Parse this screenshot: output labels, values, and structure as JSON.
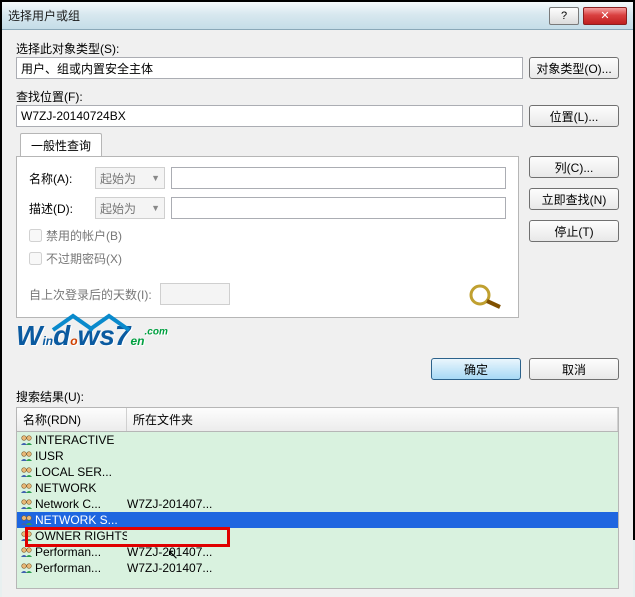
{
  "window": {
    "title": "选择用户或组"
  },
  "labels": {
    "select_type": "选择此对象类型(S):",
    "type_value": "用户、组或内置安全主体",
    "type_btn": "对象类型(O)...",
    "location_label": "查找位置(F):",
    "location_value": "W7ZJ-20140724BX",
    "location_btn": "位置(L)...",
    "tab_general": "一般性查询",
    "name_label": "名称(A):",
    "desc_label": "描述(D):",
    "combo_starts": "起始为",
    "cb_disabled": "禁用的帐户(B)",
    "cb_noexpire": "不过期密码(X)",
    "days_label": "自上次登录后的天数(I):",
    "btn_columns": "列(C)...",
    "btn_findnow": "立即查找(N)",
    "btn_stop": "停止(T)",
    "btn_ok": "确定",
    "btn_cancel": "取消",
    "results_label": "搜索结果(U):",
    "col_name": "名称(RDN)",
    "col_folder": "所在文件夹"
  },
  "results": [
    {
      "name": "INTERACTIVE",
      "folder": ""
    },
    {
      "name": "IUSR",
      "folder": ""
    },
    {
      "name": "LOCAL SER...",
      "folder": ""
    },
    {
      "name": "NETWORK",
      "folder": ""
    },
    {
      "name": "Network C...",
      "folder": "W7ZJ-201407..."
    },
    {
      "name": "NETWORK S...",
      "folder": "",
      "selected": true
    },
    {
      "name": "OWNER RIGHTS",
      "folder": ""
    },
    {
      "name": "Performan...",
      "folder": "W7ZJ-201407..."
    },
    {
      "name": "Performan...",
      "folder": "W7ZJ-201407..."
    }
  ]
}
